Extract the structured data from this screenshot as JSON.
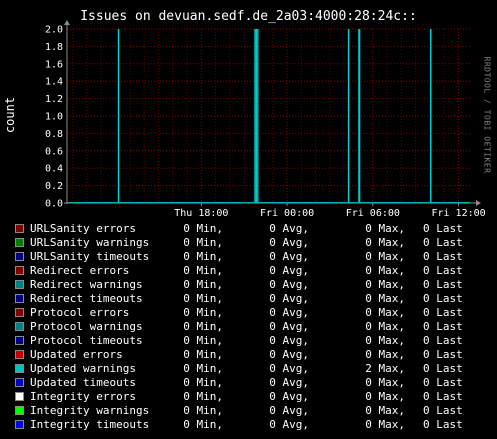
{
  "chart_data": {
    "type": "area",
    "title": "Issues on devuan.sedf.de_2a03:4000:28:24c::",
    "ylabel": "count",
    "watermark": "RRDTOOL / TOBI OETIKER",
    "ylim": [
      0,
      2.0
    ],
    "y_ticks": [
      "0.0",
      "0.2",
      "0.4",
      "0.6",
      "0.8",
      "1.0",
      "1.2",
      "1.4",
      "1.6",
      "1.8",
      "2.0"
    ],
    "x_ticks": [
      {
        "label": "Thu 18:00",
        "hour": 18
      },
      {
        "label": "Fri 00:00",
        "hour": 24
      },
      {
        "label": "Fri 06:00",
        "hour": 30
      },
      {
        "label": "Fri 12:00",
        "hour": 36
      }
    ],
    "x_range_hours": [
      8.6,
      36.8
    ],
    "grid": true,
    "series_plotted": "Updated warnings",
    "spikes": [
      {
        "hour": 12.2,
        "width_hours": 0.1,
        "value": 2.0
      },
      {
        "hour": 21.85,
        "width_hours": 0.3,
        "value": 2.0
      },
      {
        "hour": 28.3,
        "width_hours": 0.1,
        "value": 2.0
      },
      {
        "hour": 29.05,
        "width_hours": 0.15,
        "value": 2.0
      },
      {
        "hour": 34.05,
        "width_hours": 0.1,
        "value": 2.0
      }
    ],
    "colors": {
      "background": "#000000",
      "grid": "#8b0000",
      "minor_grid": "#5a0000",
      "axis": "#8a8a8a",
      "area": "#00b3b3",
      "area_edge": "#00e0e0"
    },
    "legend": [
      {
        "name": "URLSanity errors",
        "color": "#800000",
        "min": "0 Min,",
        "avg": "0 Avg,",
        "max": "0 Max,",
        "last": "0 Last"
      },
      {
        "name": "URLSanity warnings",
        "color": "#008000",
        "min": "0 Min,",
        "avg": "0 Avg,",
        "max": "0 Max,",
        "last": "0 Last"
      },
      {
        "name": "URLSanity timeouts",
        "color": "#000080",
        "min": "0 Min,",
        "avg": "0 Avg,",
        "max": "0 Max,",
        "last": "0 Last"
      },
      {
        "name": "Redirect errors",
        "color": "#800000",
        "min": "0 Min,",
        "avg": "0 Avg,",
        "max": "0 Max,",
        "last": "0 Last"
      },
      {
        "name": "Redirect warnings",
        "color": "#008080",
        "min": "0 Min,",
        "avg": "0 Avg,",
        "max": "0 Max,",
        "last": "0 Last"
      },
      {
        "name": "Redirect timeouts",
        "color": "#000080",
        "min": "0 Min,",
        "avg": "0 Avg,",
        "max": "0 Max,",
        "last": "0 Last"
      },
      {
        "name": "Protocol errors",
        "color": "#800000",
        "min": "0 Min,",
        "avg": "0 Avg,",
        "max": "0 Max,",
        "last": "0 Last"
      },
      {
        "name": "Protocol warnings",
        "color": "#008080",
        "min": "0 Min,",
        "avg": "0 Avg,",
        "max": "0 Max,",
        "last": "0 Last"
      },
      {
        "name": "Protocol timeouts",
        "color": "#000080",
        "min": "0 Min,",
        "avg": "0 Avg,",
        "max": "0 Max,",
        "last": "0 Last"
      },
      {
        "name": "Updated errors",
        "color": "#c00000",
        "min": "0 Min,",
        "avg": "0 Avg,",
        "max": "0 Max,",
        "last": "0 Last"
      },
      {
        "name": "Updated warnings",
        "color": "#00c0c0",
        "min": "0 Min,",
        "avg": "0 Avg,",
        "max": "2 Max,",
        "last": "0 Last"
      },
      {
        "name": "Updated timeouts",
        "color": "#0000c0",
        "min": "0 Min,",
        "avg": "0 Avg,",
        "max": "0 Max,",
        "last": "0 Last"
      },
      {
        "name": "Integrity errors",
        "color": "#ffffff",
        "min": "0 Min,",
        "avg": "0 Avg,",
        "max": "0 Max,",
        "last": "0 Last"
      },
      {
        "name": "Integrity warnings",
        "color": "#00ff00",
        "min": "0 Min,",
        "avg": "0 Avg,",
        "max": "0 Max,",
        "last": "0 Last"
      },
      {
        "name": "Integrity timeouts",
        "color": "#0000ff",
        "min": "0 Min,",
        "avg": "0 Avg,",
        "max": "0 Max,",
        "last": "0 Last"
      }
    ]
  }
}
